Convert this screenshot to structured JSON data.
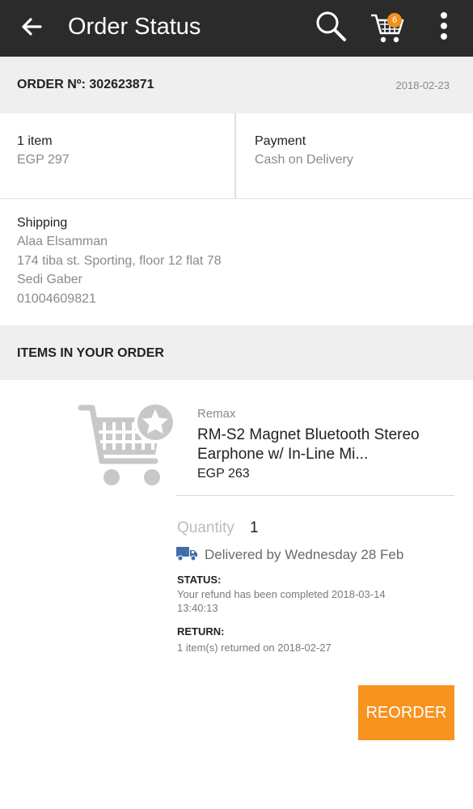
{
  "app_bar": {
    "title": "Order Status",
    "back_icon": "arrow-left-icon",
    "search_icon": "search-icon",
    "cart_icon": "cart-icon",
    "cart_count": "6",
    "menu_icon": "more-vertical-icon",
    "background_color": "#2b2b2b"
  },
  "order": {
    "number_label": "ORDER Nº: 302623871",
    "date": "2018-02-23"
  },
  "summary": {
    "items_label": "1 item",
    "items_total": "EGP 297",
    "payment_label": "Payment",
    "payment_method": "Cash on Delivery"
  },
  "shipping": {
    "label": "Shipping",
    "name": "Alaa Elsamman",
    "address": "174 tiba st. Sporting, floor 12 flat 78",
    "area": "Sedi Gaber",
    "phone": "01004609821"
  },
  "items_section": {
    "title": "ITEMS IN YOUR ORDER"
  },
  "item": {
    "image_icon": "cart-star-placeholder-icon",
    "brand": "Remax",
    "name": "RM-S2 Magnet Bluetooth Stereo Earphone w/ In-Line Mi...",
    "price": "EGP 263",
    "quantity_label": "Quantity",
    "quantity_value": "1",
    "delivery_icon": "truck-icon",
    "delivery_text": "Delivered by Wednesday 28 Feb",
    "status_label": "STATUS:",
    "status_text": "Your refund has been completed 2018-03-14 13:40:13",
    "return_label": "RETURN:",
    "return_text": "1 item(s) returned on 2018-02-27"
  },
  "actions": {
    "reorder_label": "REORDER",
    "accent_color": "#f7931e"
  }
}
